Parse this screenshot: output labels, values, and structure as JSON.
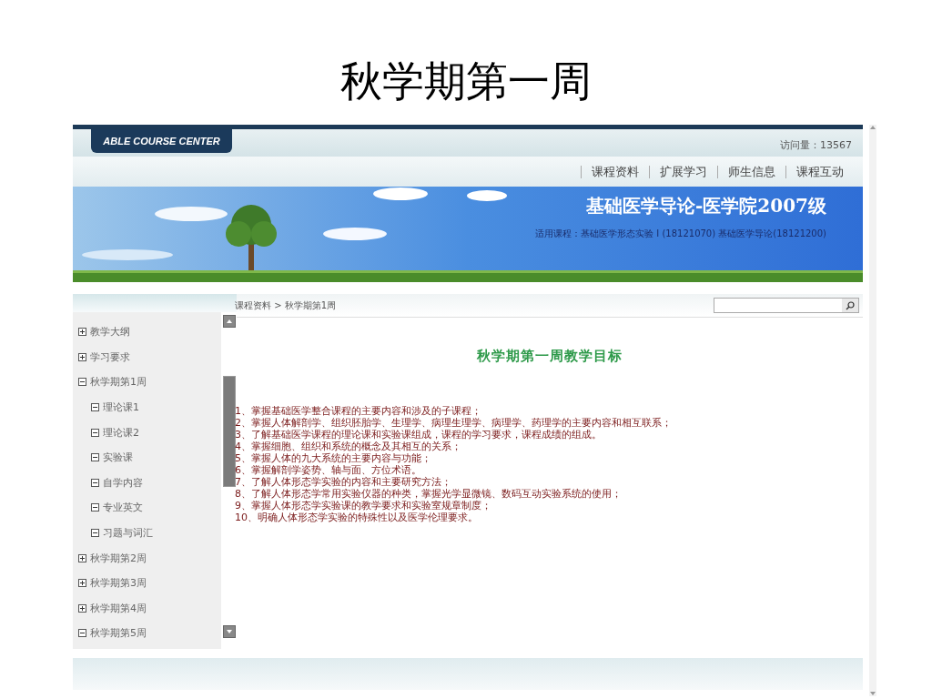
{
  "slide": {
    "title": "秋学期第一周"
  },
  "header": {
    "brand": "ABLE COURSE CENTER",
    "visits": "访问量：13567"
  },
  "nav": [
    "课程资料",
    "扩展学习",
    "师生信息",
    "课程互动"
  ],
  "banner": {
    "kind": "picture",
    "title": "基础医学导论-医学院2007级",
    "subtitle": "适用课程：基础医学形态实验 I (18121070) 基础医学导论(18121200)"
  },
  "sidebar": {
    "items": [
      {
        "label": "教学大纲",
        "expanded": false
      },
      {
        "label": "学习要求",
        "expanded": false
      },
      {
        "label": "秋学期第1周",
        "expanded": true,
        "children": [
          {
            "label": "理论课1",
            "expanded": true
          },
          {
            "label": "理论课2",
            "expanded": true
          },
          {
            "label": "实验课",
            "expanded": true
          },
          {
            "label": "自学内容",
            "expanded": true
          },
          {
            "label": "专业英文",
            "expanded": true
          },
          {
            "label": "习题与词汇",
            "expanded": true
          }
        ]
      },
      {
        "label": "秋学期第2周",
        "expanded": false
      },
      {
        "label": "秋学期第3周",
        "expanded": false
      },
      {
        "label": "秋学期第4周",
        "expanded": false
      },
      {
        "label": "秋学期第5周",
        "expanded": true
      }
    ]
  },
  "breadcrumb": "课程资料 > 秋学期第1周",
  "heading": "秋学期第一周教学目标",
  "objectives": [
    "1、掌握基础医学整合课程的主要内容和涉及的子课程；",
    "2、掌握人体解剖学、组织胚胎学、生理学、病理生理学、病理学、药理学的主要内容和相互联系；",
    "3、了解基础医学课程的理论课和实验课组成，课程的学习要求，课程成绩的组成。",
    "4、掌握细胞、组织和系统的概念及其相互的关系；",
    "5、掌握人体的九大系统的主要内容与功能；",
    "6、掌握解剖学姿势、轴与面、方位术语。",
    "7、了解人体形态学实验的内容和主要研究方法；",
    "8、了解人体形态学常用实验仪器的种类，掌握光学显微镜、数码互动实验系统的使用；",
    "9、掌握人体形态学实验课的教学要求和实验室规章制度；",
    "10、明确人体形态学实验的特殊性以及医学伦理要求。"
  ]
}
